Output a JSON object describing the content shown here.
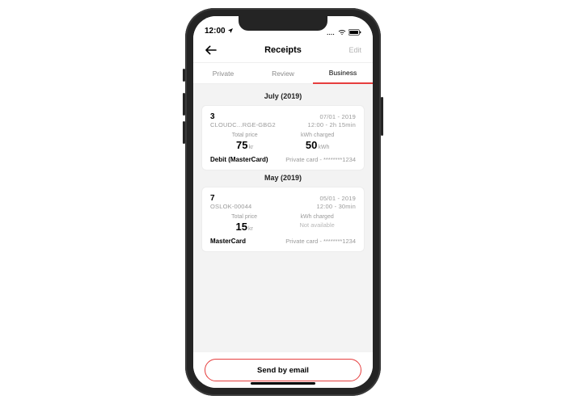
{
  "statusbar": {
    "time": "12:00"
  },
  "nav": {
    "title": "Receipts",
    "edit": "Edit"
  },
  "tabs": [
    "Private",
    "Review",
    "Business"
  ],
  "active_tab": 2,
  "sections": [
    {
      "month_label": "July (2019)",
      "card": {
        "day": "3",
        "location": "CLOUDC...RGE-GBG2",
        "date": "07/01  - 2019",
        "time": "12:00 - 2h 15min",
        "total_price_label": "Total price",
        "total_price_value": "75",
        "total_price_unit": "kr",
        "kwh_label": "kWh charged",
        "kwh_value": "50",
        "kwh_unit": "kWh",
        "pay_method": "Debit (MasterCard)",
        "pay_card": "Private card - ********1234"
      }
    },
    {
      "month_label": "May (2019)",
      "card": {
        "day": "7",
        "location": "OSLOK-00044",
        "date": "05/01  - 2019",
        "time": "12:00 - 30min",
        "total_price_label": "Total price",
        "total_price_value": "15",
        "total_price_unit": "kr",
        "kwh_label": "kWh charged",
        "kwh_na": "Not available",
        "pay_method": "MasterCard",
        "pay_card": "Private card - ********1234"
      }
    }
  ],
  "cta": "Send by email"
}
